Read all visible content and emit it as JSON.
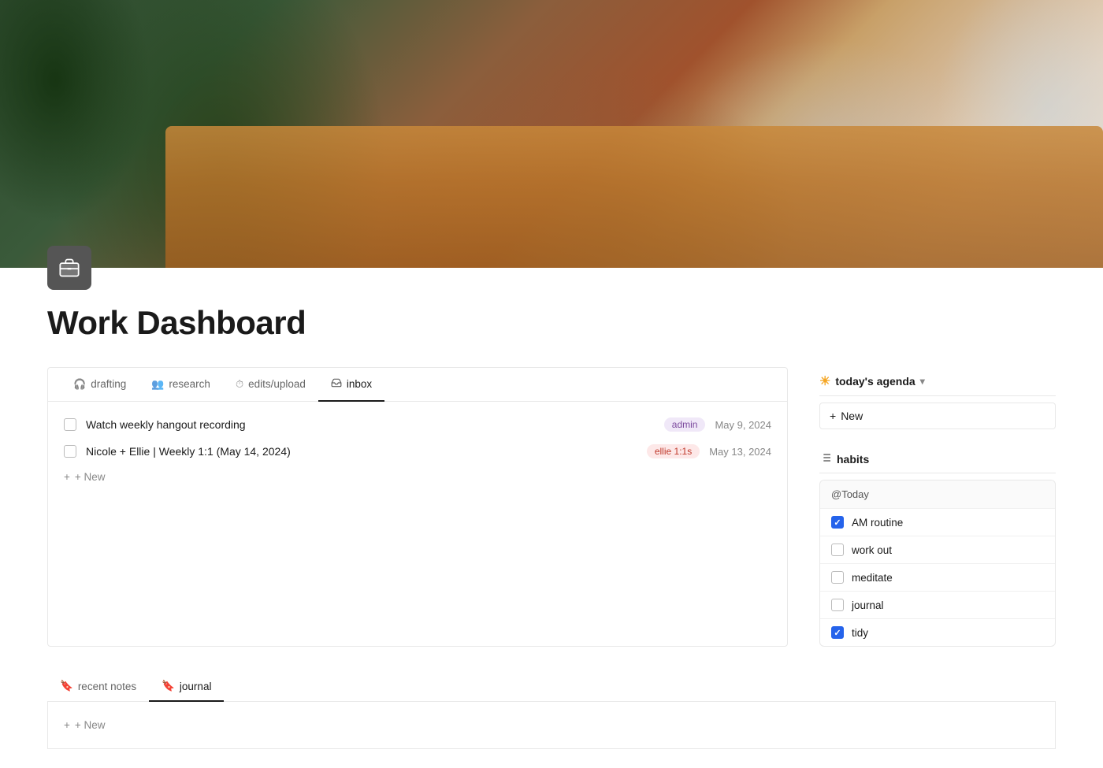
{
  "page": {
    "title": "Work Dashboard",
    "icon": "💼"
  },
  "tabs": [
    {
      "id": "drafting",
      "label": "drafting",
      "icon": "🎧",
      "active": false
    },
    {
      "id": "research",
      "label": "research",
      "icon": "👥",
      "active": false
    },
    {
      "id": "edits-upload",
      "label": "edits/upload",
      "icon": "⏱",
      "active": false
    },
    {
      "id": "inbox",
      "label": "inbox",
      "icon": "📋",
      "active": true
    }
  ],
  "tasks": [
    {
      "id": 1,
      "title": "Watch weekly hangout recording",
      "tag": "admin",
      "tagClass": "tag-admin",
      "date": "May 9, 2024"
    },
    {
      "id": 2,
      "title": "Nicole + Ellie | Weekly 1:1 (May 14, 2024)",
      "tag": "ellie 1:1s",
      "tagClass": "tag-ellie",
      "date": "May 13, 2024"
    }
  ],
  "new_task_label": "+ New",
  "bottom_tabs": [
    {
      "id": "recent-notes",
      "label": "recent notes",
      "icon": "🔖",
      "active": false
    },
    {
      "id": "journal",
      "label": "journal",
      "icon": "🔖",
      "active": true
    }
  ],
  "bottom_new_label": "+ New",
  "agenda": {
    "title": "today's agenda",
    "sun_icon": "☀",
    "new_button": "New",
    "header_at_today": "@Today"
  },
  "habits": {
    "title": "habits",
    "items": [
      {
        "label": "AM routine",
        "checked": true
      },
      {
        "label": "work out",
        "checked": false
      },
      {
        "label": "meditate",
        "checked": false
      },
      {
        "label": "journal",
        "checked": false
      },
      {
        "label": "tidy",
        "checked": true
      }
    ]
  }
}
